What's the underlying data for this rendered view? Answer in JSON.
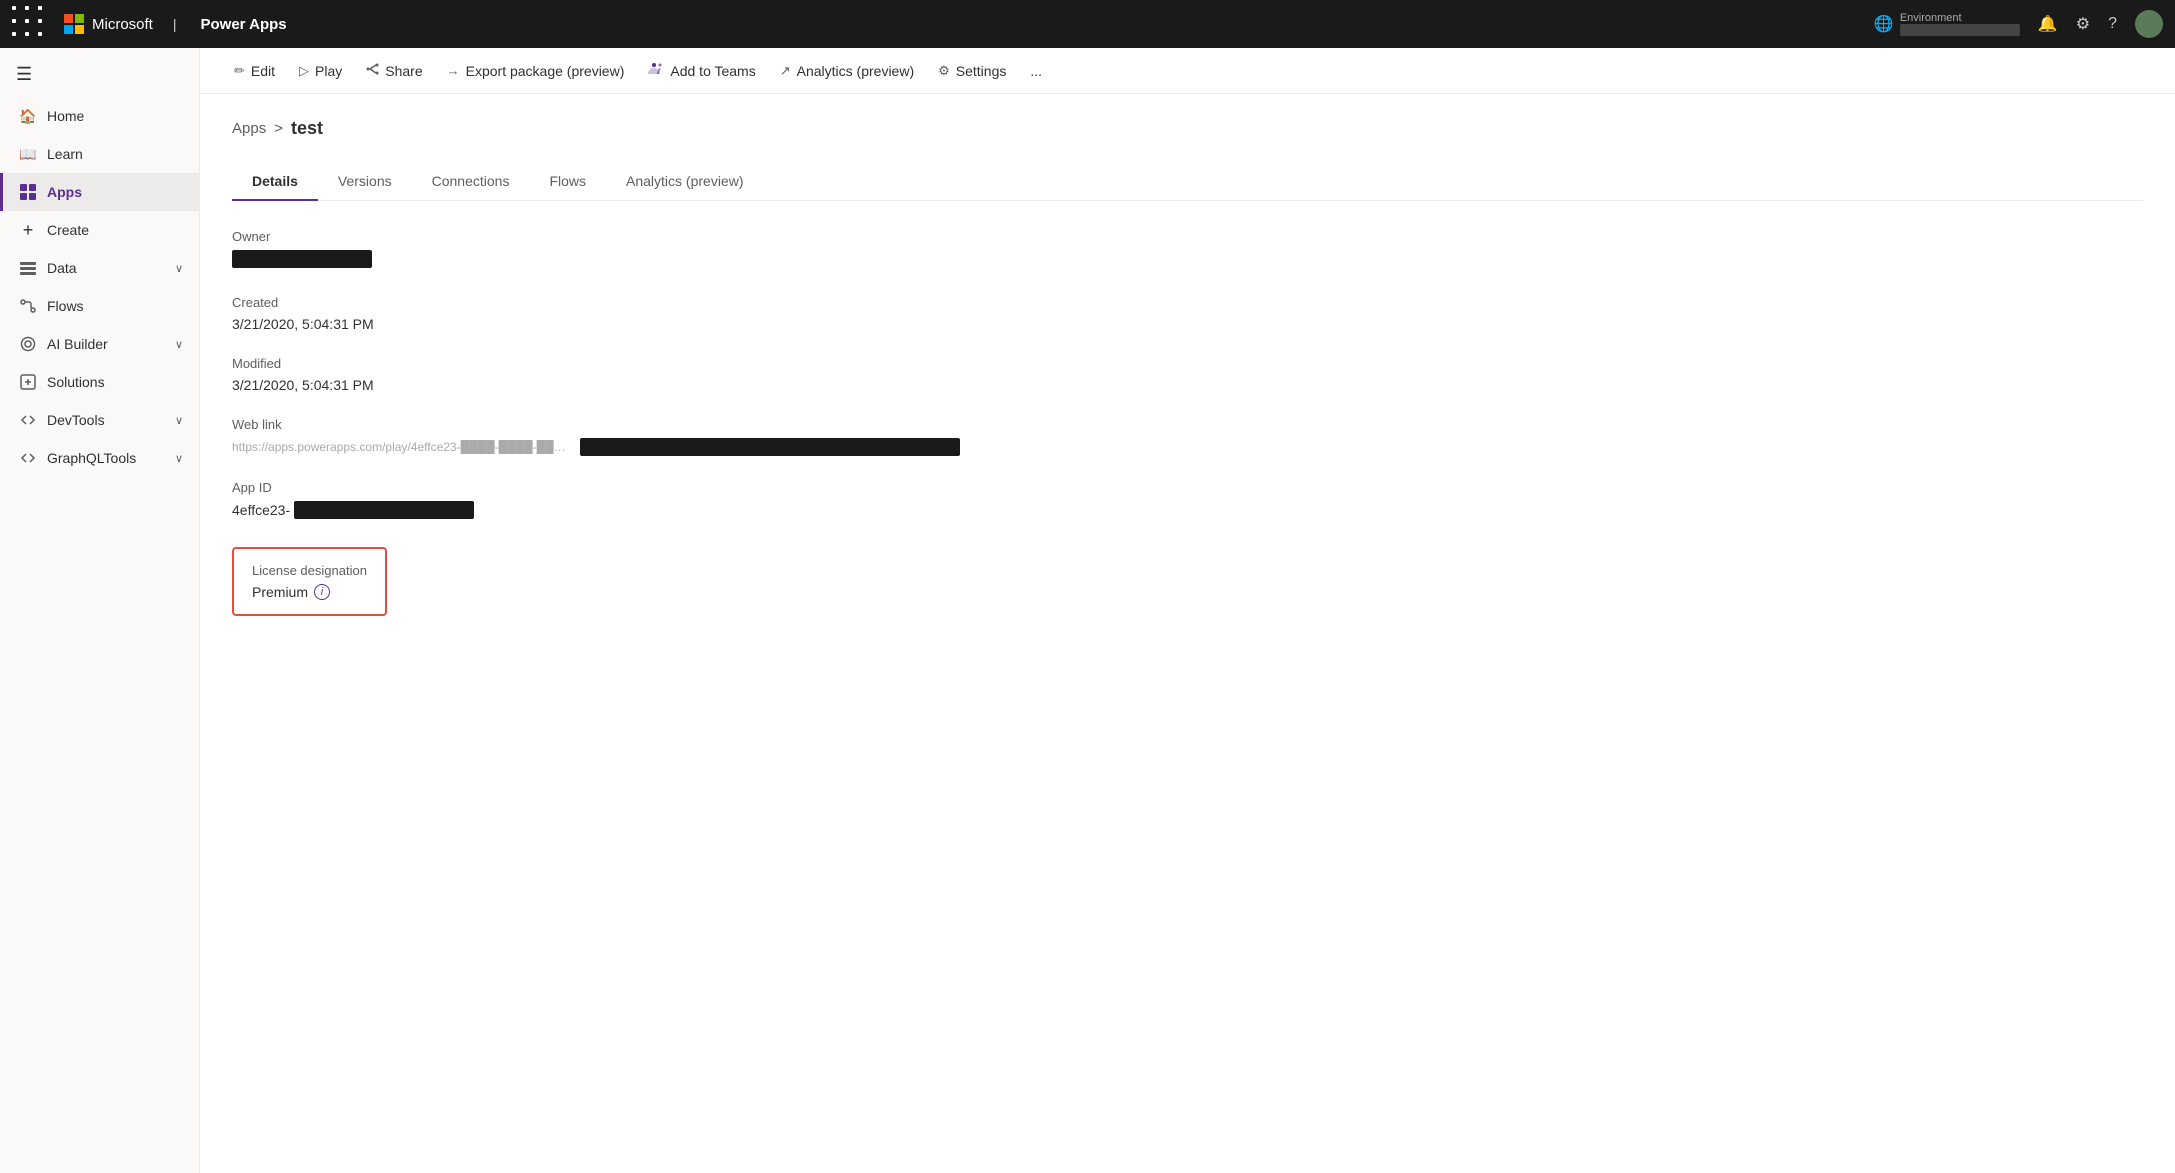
{
  "topnav": {
    "brand": "Power Apps",
    "environment_label": "Environment",
    "environment_value": "████████████"
  },
  "sidebar": {
    "hamburger": "☰",
    "items": [
      {
        "id": "home",
        "label": "Home",
        "icon": "🏠",
        "hasChevron": false,
        "active": false
      },
      {
        "id": "learn",
        "label": "Learn",
        "icon": "📖",
        "hasChevron": false,
        "active": false
      },
      {
        "id": "apps",
        "label": "Apps",
        "icon": "⊞",
        "hasChevron": false,
        "active": true
      },
      {
        "id": "create",
        "label": "Create",
        "icon": "+",
        "hasChevron": false,
        "active": false
      },
      {
        "id": "data",
        "label": "Data",
        "icon": "⊞",
        "hasChevron": true,
        "active": false
      },
      {
        "id": "flows",
        "label": "Flows",
        "icon": "⟳",
        "hasChevron": false,
        "active": false
      },
      {
        "id": "ai-builder",
        "label": "AI Builder",
        "icon": "⚙",
        "hasChevron": true,
        "active": false
      },
      {
        "id": "solutions",
        "label": "Solutions",
        "icon": "⊡",
        "hasChevron": false,
        "active": false
      },
      {
        "id": "devtools",
        "label": "DevTools",
        "icon": "⚒",
        "hasChevron": true,
        "active": false
      },
      {
        "id": "graphqltools",
        "label": "GraphQLTools",
        "icon": "⚒",
        "hasChevron": true,
        "active": false
      }
    ]
  },
  "toolbar": {
    "buttons": [
      {
        "id": "edit",
        "label": "Edit",
        "icon": "✏"
      },
      {
        "id": "play",
        "label": "Play",
        "icon": "▷"
      },
      {
        "id": "share",
        "label": "Share",
        "icon": "↗"
      },
      {
        "id": "export",
        "label": "Export package (preview)",
        "icon": "⟶"
      },
      {
        "id": "add-to-teams",
        "label": "Add to Teams",
        "icon": "👥"
      },
      {
        "id": "analytics",
        "label": "Analytics (preview)",
        "icon": "↗"
      },
      {
        "id": "settings",
        "label": "Settings",
        "icon": "⚙"
      },
      {
        "id": "more",
        "label": "...",
        "icon": ""
      }
    ]
  },
  "breadcrumb": {
    "parent": "Apps",
    "separator": ">",
    "current": "test"
  },
  "tabs": [
    {
      "id": "details",
      "label": "Details",
      "active": true
    },
    {
      "id": "versions",
      "label": "Versions",
      "active": false
    },
    {
      "id": "connections",
      "label": "Connections",
      "active": false
    },
    {
      "id": "flows",
      "label": "Flows",
      "active": false
    },
    {
      "id": "analytics",
      "label": "Analytics (preview)",
      "active": false
    }
  ],
  "details": {
    "owner_label": "Owner",
    "created_label": "Created",
    "created_value": "3/21/2020, 5:04:31 PM",
    "modified_label": "Modified",
    "modified_value": "3/21/2020, 5:04:31 PM",
    "weblink_label": "Web link",
    "weblink_blurred": "https://apps.powerapps.com/play/4effce23-████-████-████-████████████?tenantId=████████████",
    "appid_label": "App ID",
    "appid_prefix": "4effce23-",
    "license_label": "License designation",
    "license_value": "Premium",
    "info_icon": "i"
  }
}
